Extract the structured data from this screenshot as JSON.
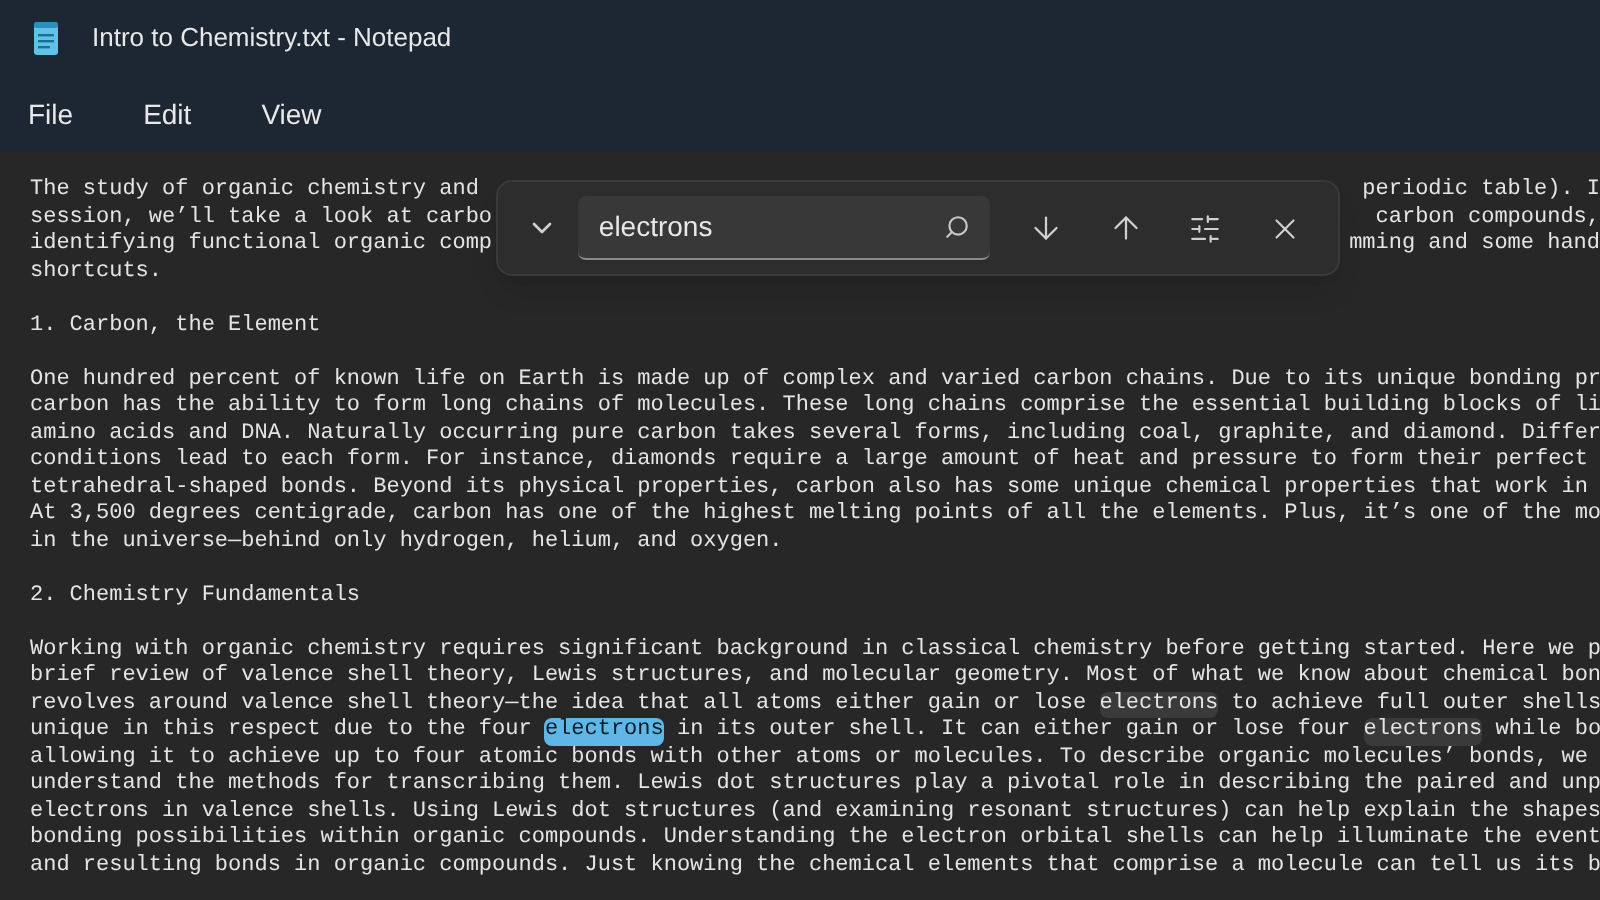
{
  "window": {
    "title": "Intro to Chemistry.txt - Notepad"
  },
  "menu": [
    "File",
    "Edit",
    "View"
  ],
  "find_bar": {
    "value": "electrons"
  },
  "lines": [
    {
      "kind": "covered",
      "left": "The study of organic chemistry and",
      "right": "periodic table). I"
    },
    {
      "kind": "covered",
      "left": "session, we’ll take a look at carbo",
      "right": "carbon compounds,"
    },
    {
      "kind": "covered",
      "left": "identifying functional organic comp",
      "right": "mming and some hand"
    },
    {
      "kind": "plain",
      "text": "shortcuts."
    },
    {
      "kind": "blank"
    },
    {
      "kind": "plain",
      "text": "1. Carbon, the Element"
    },
    {
      "kind": "blank"
    },
    {
      "kind": "plain",
      "text": "One hundred percent of known life on Earth is made up of complex and varied carbon chains. Due to its unique bonding pr"
    },
    {
      "kind": "plain",
      "text": "carbon has the ability to form long chains of molecules. These long chains comprise the essential building blocks of li"
    },
    {
      "kind": "plain",
      "text": "amino acids and DNA. Naturally occurring pure carbon takes several forms, including coal, graphite, and diamond. Differ"
    },
    {
      "kind": "plain",
      "text": "conditions lead to each form. For instance, diamonds require a large amount of heat and pressure to form their perfect"
    },
    {
      "kind": "plain",
      "text": "tetrahedral-shaped bonds. Beyond its physical properties, carbon also has some unique chemical properties that work in"
    },
    {
      "kind": "plain",
      "text": "At 3,500 degrees centigrade, carbon has one of the highest melting points of all the elements. Plus, it’s one of the mo"
    },
    {
      "kind": "plain",
      "text": "in the universe—behind only hydrogen, helium, and oxygen."
    },
    {
      "kind": "blank"
    },
    {
      "kind": "plain",
      "text": "2. Chemistry Fundamentals"
    },
    {
      "kind": "blank"
    },
    {
      "kind": "plain",
      "text": "Working with organic chemistry requires significant background in classical chemistry before getting started. Here we p"
    },
    {
      "kind": "plain",
      "text": "brief review of valence shell theory, Lewis structures, and molecular geometry. Most of what we know about chemical bon"
    },
    {
      "kind": "highlighted",
      "segments": [
        {
          "text": "revolves around valence shell theory—the idea that all atoms either gain or lose ",
          "match": false,
          "selected": false
        },
        {
          "text": "electrons",
          "match": true,
          "selected": false
        },
        {
          "text": " to achieve full outer shells",
          "match": false,
          "selected": false
        }
      ]
    },
    {
      "kind": "highlighted",
      "segments": [
        {
          "text": "unique in this respect due to the four ",
          "match": false,
          "selected": false
        },
        {
          "text": "electrons",
          "match": true,
          "selected": true
        },
        {
          "text": " in its outer shell. It can either gain or lose four ",
          "match": false,
          "selected": false
        },
        {
          "text": "electrons",
          "match": true,
          "selected": false
        },
        {
          "text": " while bo",
          "match": false,
          "selected": false
        }
      ]
    },
    {
      "kind": "plain",
      "text": "allowing it to achieve up to four atomic bonds with other atoms or molecules. To describe organic molecules’ bonds, we"
    },
    {
      "kind": "plain",
      "text": "understand the methods for transcribing them. Lewis dot structures play a pivotal role in describing the paired and unp"
    },
    {
      "kind": "plain",
      "text": "electrons in valence shells. Using Lewis dot structures (and examining resonant structures) can help explain the shapes"
    },
    {
      "kind": "plain",
      "text": "bonding possibilities within organic compounds. Understanding the electron orbital shells can help illuminate the event"
    },
    {
      "kind": "plain",
      "text": "and resulting bonds in organic compounds. Just knowing the chemical elements that comprise a molecule can tell us its b"
    }
  ]
}
